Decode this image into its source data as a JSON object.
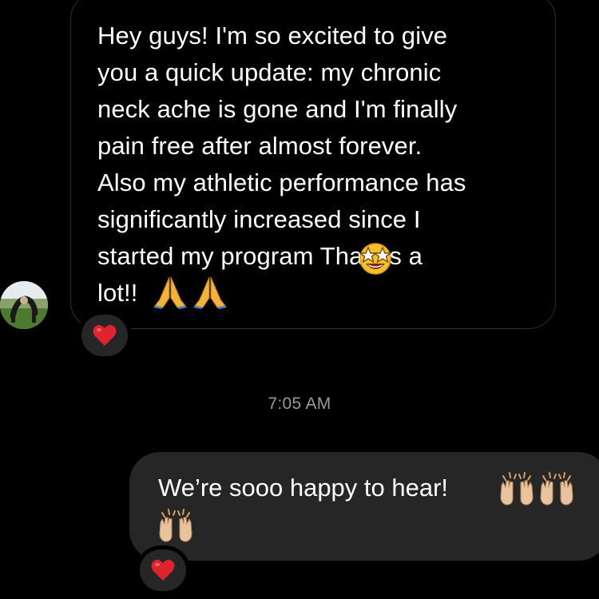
{
  "conversation": {
    "incoming_message": {
      "text": "Hey guys! I'm so excited to give\nyou a quick update: my chronic\nneck ache is gone and I'm finally\npain free after almost forever.\nAlso my athletic performance has\nsignificantly increased since I\nstarted my program           Thanks a\nlot!!",
      "inline_emojis": [
        "star-struck",
        "folded-hands",
        "folded-hands"
      ],
      "reaction": "red-heart"
    },
    "timestamp": "7:05 AM",
    "outgoing_message": {
      "text": "We’re sooo happy to hear!",
      "inline_emojis": [
        "raising-hands",
        "raising-hands",
        "raising-hands"
      ],
      "reaction": "red-heart"
    }
  },
  "colors": {
    "background": "#000000",
    "outgoing_bubble": "#262626",
    "incoming_border": "#2e2e2e",
    "timestamp": "#9a9a9a",
    "heart": "#e0242f"
  }
}
